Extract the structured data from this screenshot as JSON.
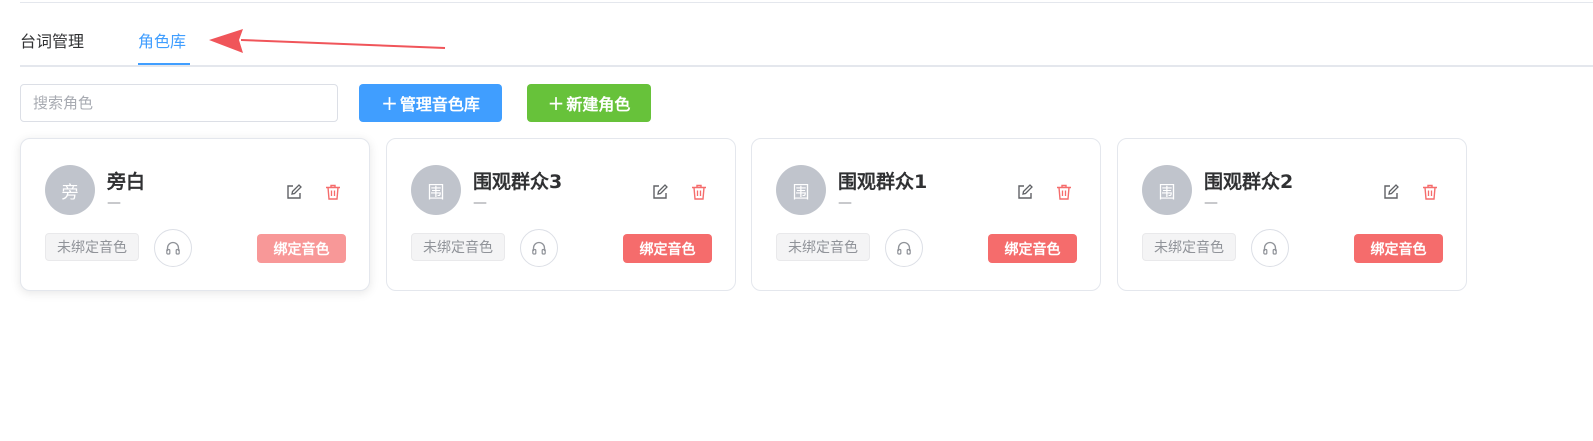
{
  "tabs": [
    {
      "label": "台词管理",
      "active": false
    },
    {
      "label": "角色库",
      "active": true
    }
  ],
  "toolbar": {
    "search_placeholder": "搜索角色",
    "manage_voice_label": "管理音色库",
    "new_role_label": "新建角色",
    "plus": "+"
  },
  "roles": [
    {
      "avatar_char": "旁",
      "name": "旁白",
      "subtitle": "—",
      "voice_tag": "未绑定音色",
      "bind_label": "绑定音色"
    },
    {
      "avatar_char": "围",
      "name": "围观群众3",
      "subtitle": "—",
      "voice_tag": "未绑定音色",
      "bind_label": "绑定音色"
    },
    {
      "avatar_char": "围",
      "name": "围观群众1",
      "subtitle": "—",
      "voice_tag": "未绑定音色",
      "bind_label": "绑定音色"
    },
    {
      "avatar_char": "围",
      "name": "围观群众2",
      "subtitle": "—",
      "voice_tag": "未绑定音色",
      "bind_label": "绑定音色"
    }
  ],
  "colors": {
    "primary": "#409eff",
    "success": "#67c23a",
    "danger": "#f56c6c",
    "annotation_arrow": "#f0555a"
  },
  "icons": [
    "edit-icon",
    "delete-icon",
    "headphones-icon",
    "annotation-arrow-icon"
  ]
}
